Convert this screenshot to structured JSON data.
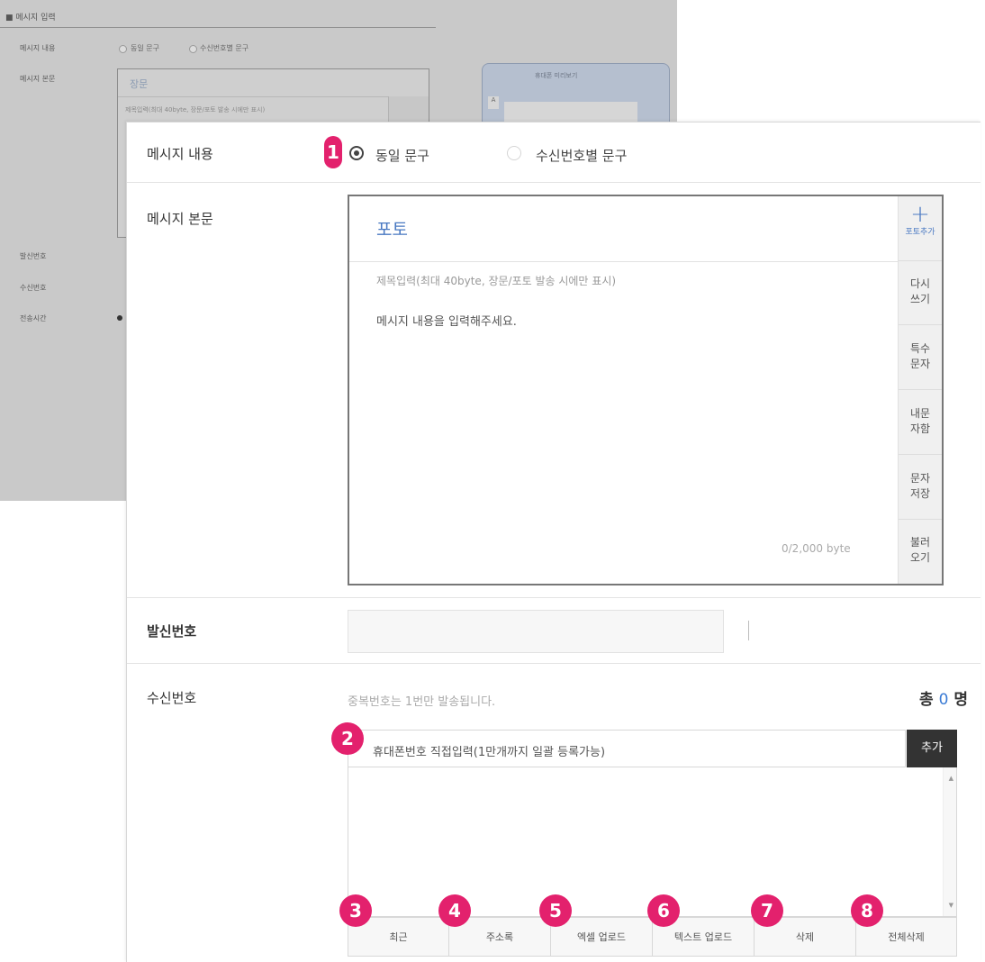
{
  "background_screenshot": {
    "title": "■ 메시지 입력",
    "labels": [
      "메시지 내용",
      "메시지 본문",
      "발신번호",
      "수신번호",
      "전송시간"
    ],
    "options": [
      "동일 문구",
      "수신번호별 문구"
    ],
    "editor_title": "장문",
    "editor_subject": "제목입력(최대 40byte, 장문/포토 발송 시에만 표시)",
    "phone_header": "휴대폰 미리보기",
    "phone_icon": "A"
  },
  "message_content": {
    "label": "메시지 내용",
    "options": [
      {
        "label": "동일 문구",
        "selected": true
      },
      {
        "label": "수신번호별 문구",
        "selected": false
      }
    ]
  },
  "message_body": {
    "label": "메시지 본문",
    "type_title": "포토",
    "subject_placeholder": "제목입력(최대 40byte, 장문/포토 발송 시에만 표시)",
    "body_placeholder": "메시지 내용을 입력해주세요.",
    "byte_counter": "0/2,000 byte",
    "side_buttons": {
      "photo_add": {
        "icon": "+",
        "label": "포토추가"
      },
      "rewrite": [
        "다시",
        "쓰기"
      ],
      "special_char": [
        "특수",
        "문자"
      ],
      "my_text": [
        "내문",
        "자함"
      ],
      "save_text": [
        "문자",
        "저장"
      ],
      "load": [
        "불러",
        "오기"
      ]
    }
  },
  "sender": {
    "label": "발신번호"
  },
  "receiver": {
    "label": "수신번호",
    "note": "중복번호는 1번만 발송됩니다.",
    "total_prefix": "총",
    "total_count": "0",
    "total_suffix": "명",
    "input_placeholder": "휴대폰번호 직접입력(1만개까지 일괄 등록가능)",
    "add_button": "추가",
    "scroll_up": "▲",
    "scroll_down": "▼",
    "tools": [
      "최근",
      "주소록",
      "엑셀 업로드",
      "텍스트 업로드",
      "삭제",
      "전체삭제"
    ]
  },
  "markers": [
    "1",
    "2",
    "3",
    "4",
    "5",
    "6",
    "7",
    "8"
  ],
  "colors": {
    "marker": "#e3216d",
    "accent_blue": "#4a79c2",
    "add_button_bg": "#333333"
  }
}
